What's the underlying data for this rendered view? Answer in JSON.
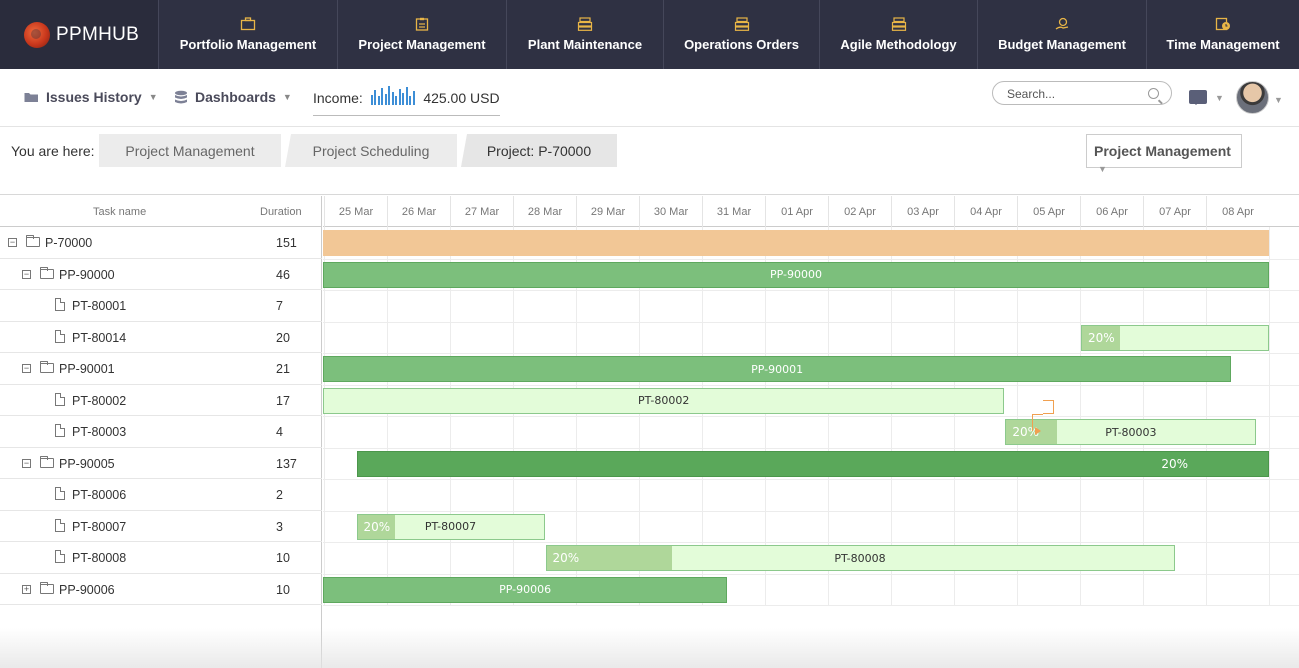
{
  "brand": {
    "name": "PPMHUB"
  },
  "nav": [
    {
      "label": "Portfolio Management",
      "icon": "briefcase-icon"
    },
    {
      "label": "Project Management",
      "icon": "clipboard-icon"
    },
    {
      "label": "Plant Maintenance",
      "icon": "stack-icon"
    },
    {
      "label": "Operations Orders",
      "icon": "stack-icon"
    },
    {
      "label": "Agile Methodology",
      "icon": "stack-icon"
    },
    {
      "label": "Budget Management",
      "icon": "coins-icon"
    },
    {
      "label": "Time Management",
      "icon": "clock-icon"
    }
  ],
  "subbar": {
    "issues_history": "Issues History",
    "dashboards": "Dashboards",
    "income_label": "Income:",
    "income_value": "425.00 USD",
    "income_bars": [
      0.55,
      0.8,
      0.45,
      0.9,
      0.6,
      1.0,
      0.7,
      0.5,
      0.85,
      0.65,
      0.95,
      0.5,
      0.75
    ],
    "search_placeholder": "Search..."
  },
  "breadcrumb": {
    "label": "You are here:",
    "items": [
      "Project Management",
      "Project Scheduling",
      "Project: P-70000"
    ],
    "module_select": "Project Management"
  },
  "grid": {
    "col_task": "Task name",
    "col_duration": "Duration",
    "rows": [
      {
        "name": "P-70000",
        "duration": "151",
        "level": 0,
        "type": "folder",
        "toggle": "−"
      },
      {
        "name": "PP-90000",
        "duration": "46",
        "level": 1,
        "type": "folder",
        "toggle": "−"
      },
      {
        "name": "PT-80001",
        "duration": "7",
        "level": 2,
        "type": "file"
      },
      {
        "name": "PT-80014",
        "duration": "20",
        "level": 2,
        "type": "file"
      },
      {
        "name": "PP-90001",
        "duration": "21",
        "level": 1,
        "type": "folder",
        "toggle": "−"
      },
      {
        "name": "PT-80002",
        "duration": "17",
        "level": 2,
        "type": "file"
      },
      {
        "name": "PT-80003",
        "duration": "4",
        "level": 2,
        "type": "file"
      },
      {
        "name": "PP-90005",
        "duration": "137",
        "level": 1,
        "type": "folder",
        "toggle": "−"
      },
      {
        "name": "PT-80006",
        "duration": "2",
        "level": 2,
        "type": "file"
      },
      {
        "name": "PT-80007",
        "duration": "3",
        "level": 2,
        "type": "file"
      },
      {
        "name": "PT-80008",
        "duration": "10",
        "level": 2,
        "type": "file"
      },
      {
        "name": "PP-90006",
        "duration": "10",
        "level": 1,
        "type": "folder",
        "toggle": "+"
      }
    ]
  },
  "gantt": {
    "days": [
      "Mar",
      "25 Mar",
      "26 Mar",
      "27 Mar",
      "28 Mar",
      "29 Mar",
      "30 Mar",
      "31 Mar",
      "01 Apr",
      "02 Apr",
      "03 Apr",
      "04 Apr",
      "05 Apr",
      "06 Apr",
      "07 Apr",
      "08 Apr"
    ],
    "bars": [
      {
        "row": 0,
        "kind": "proj",
        "label": "",
        "start": 24,
        "end": 40,
        "progress": ""
      },
      {
        "row": 1,
        "kind": "grp",
        "label": "PP-90000",
        "start": 24,
        "end": 40,
        "progress": ""
      },
      {
        "row": 3,
        "kind": "task",
        "label": "",
        "start": 37.0,
        "end": 40,
        "progress": "20%",
        "progress_fraction": 0.2
      },
      {
        "row": 4,
        "kind": "grp",
        "label": "PP-90001",
        "start": 24,
        "end": 39.4,
        "progress": ""
      },
      {
        "row": 5,
        "kind": "task",
        "label": "PT-80002",
        "start": 24,
        "end": 35.8,
        "progress": ""
      },
      {
        "row": 6,
        "kind": "task",
        "label": "PT-80003",
        "start": 35.8,
        "end": 39.8,
        "progress": "20%",
        "progress_fraction": 0.2
      },
      {
        "row": 7,
        "kind": "grpd",
        "label": "",
        "start": 25.5,
        "end": 40,
        "progress": "20%",
        "progress_fraction": 0.2
      },
      {
        "row": 9,
        "kind": "task",
        "label": "PT-80007",
        "start": 25.5,
        "end": 28.5,
        "progress": "20%",
        "progress_fraction": 0.2
      },
      {
        "row": 10,
        "kind": "task",
        "label": "PT-80008",
        "start": 28.5,
        "end": 38.5,
        "progress": "20%",
        "progress_fraction": 0.2
      },
      {
        "row": 11,
        "kind": "grp",
        "label": "PP-90006",
        "start": 24,
        "end": 31.4,
        "progress": ""
      }
    ]
  }
}
